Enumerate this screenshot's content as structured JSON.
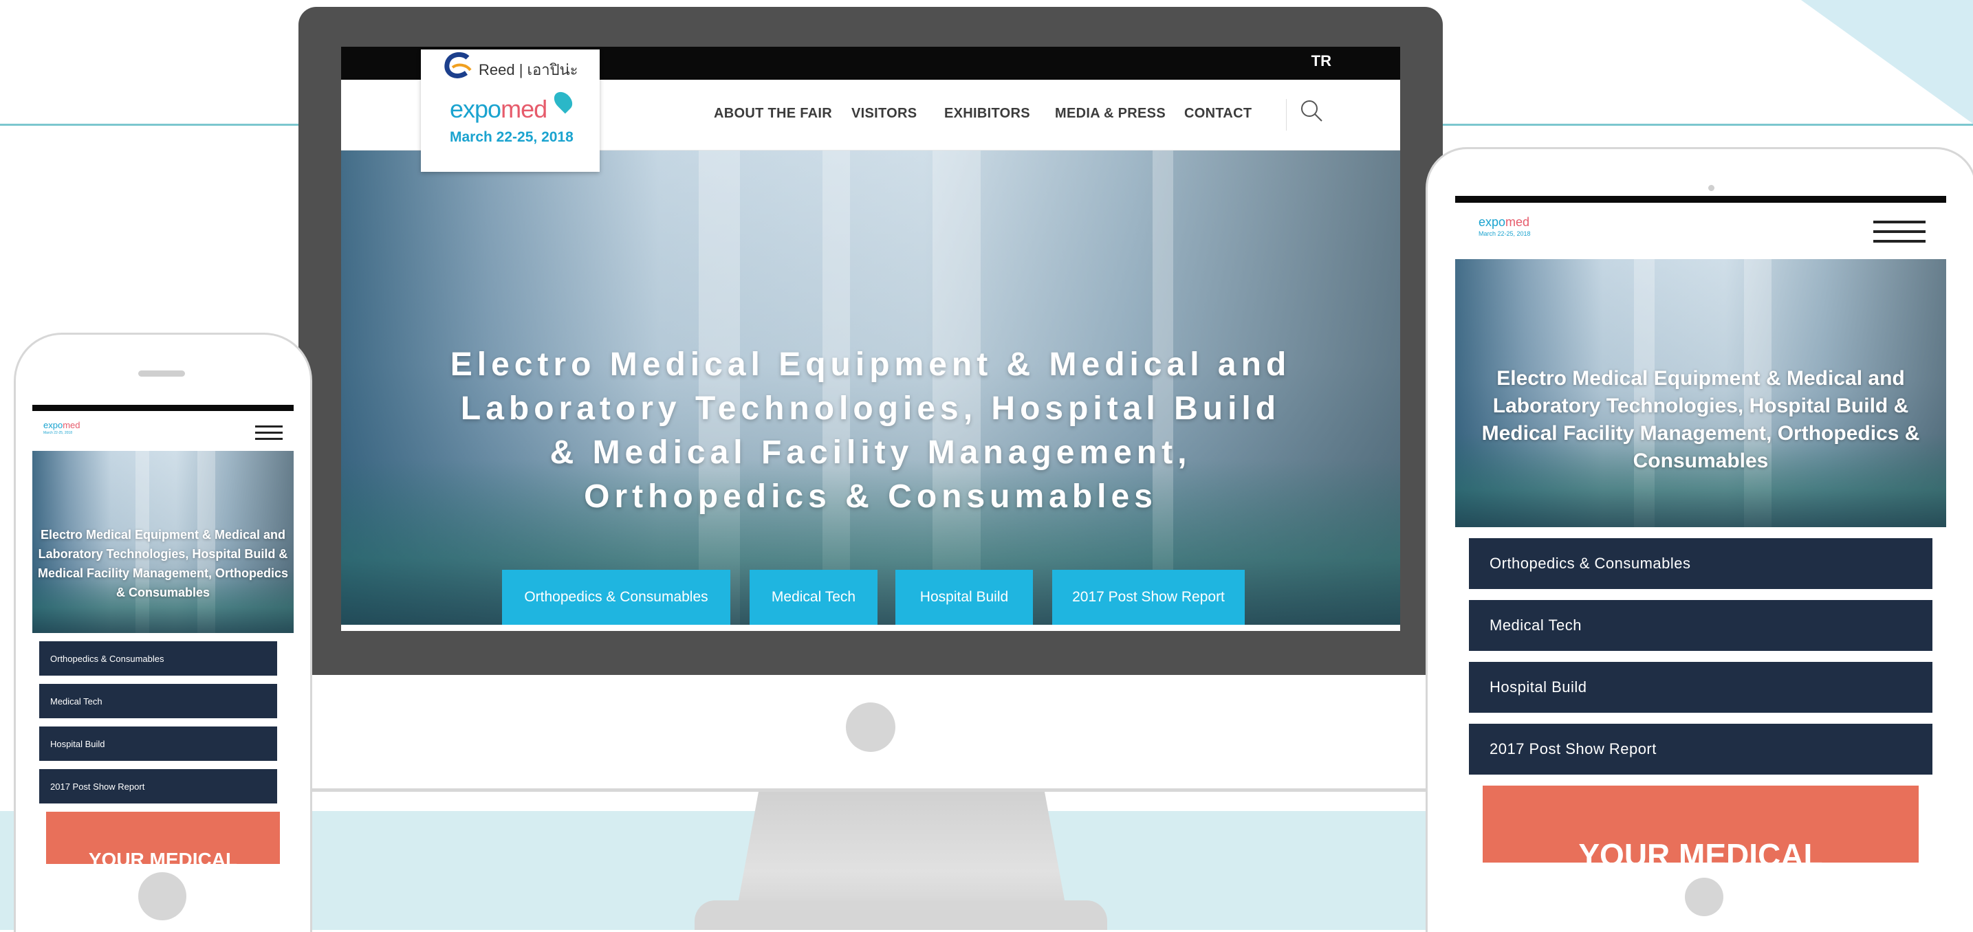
{
  "colors": {
    "accent": "#1fb5e0",
    "navy_button": "#1f2e45",
    "cta_coral": "#e8705a",
    "brand_blue": "#1aa3cf",
    "brand_pink": "#e65b6b"
  },
  "desktop": {
    "topbar": {
      "language": "TR"
    },
    "logo": {
      "reed": "Reed",
      "reed_suffix": "เอาปิน่ะ",
      "brand_prefix": "expo",
      "brand_highlight": "med",
      "date": "March 22-25, 2018"
    },
    "nav": [
      "ABOUT THE FAIR",
      "VISITORS",
      "EXHIBITORS",
      "MEDIA & PRESS",
      "CONTACT"
    ],
    "hero_title": "Electro Medical Equipment & Medical and Laboratory Technologies, Hospital Build & Medical Facility Management, Orthopedics & Consumables",
    "buttons": [
      "Orthopedics & Consumables",
      "Medical Tech",
      "Hospital Build",
      "2017 Post Show Report"
    ]
  },
  "tablet": {
    "logo": {
      "brand_prefix": "expo",
      "brand_highlight": "med",
      "date": "March 22-25, 2018"
    },
    "hero_title": "Electro Medical Equipment & Medical and Laboratory Technologies, Hospital Build & Medical Facility Management, Orthopedics & Consumables",
    "buttons": [
      "Orthopedics & Consumables",
      "Medical Tech",
      "Hospital Build",
      "2017 Post Show Report"
    ],
    "cta": "YOUR MEDICAL"
  },
  "phone": {
    "logo": {
      "brand_prefix": "expo",
      "brand_highlight": "med",
      "date": "March 22-25, 2018"
    },
    "hero_title": "Electro Medical Equipment & Medical and Laboratory Technologies, Hospital Build & Medical Facility Management, Orthopedics & Consumables",
    "buttons": [
      "Orthopedics & Consumables",
      "Medical Tech",
      "Hospital Build",
      "2017 Post Show Report"
    ],
    "cta": "YOUR MEDICAL"
  }
}
